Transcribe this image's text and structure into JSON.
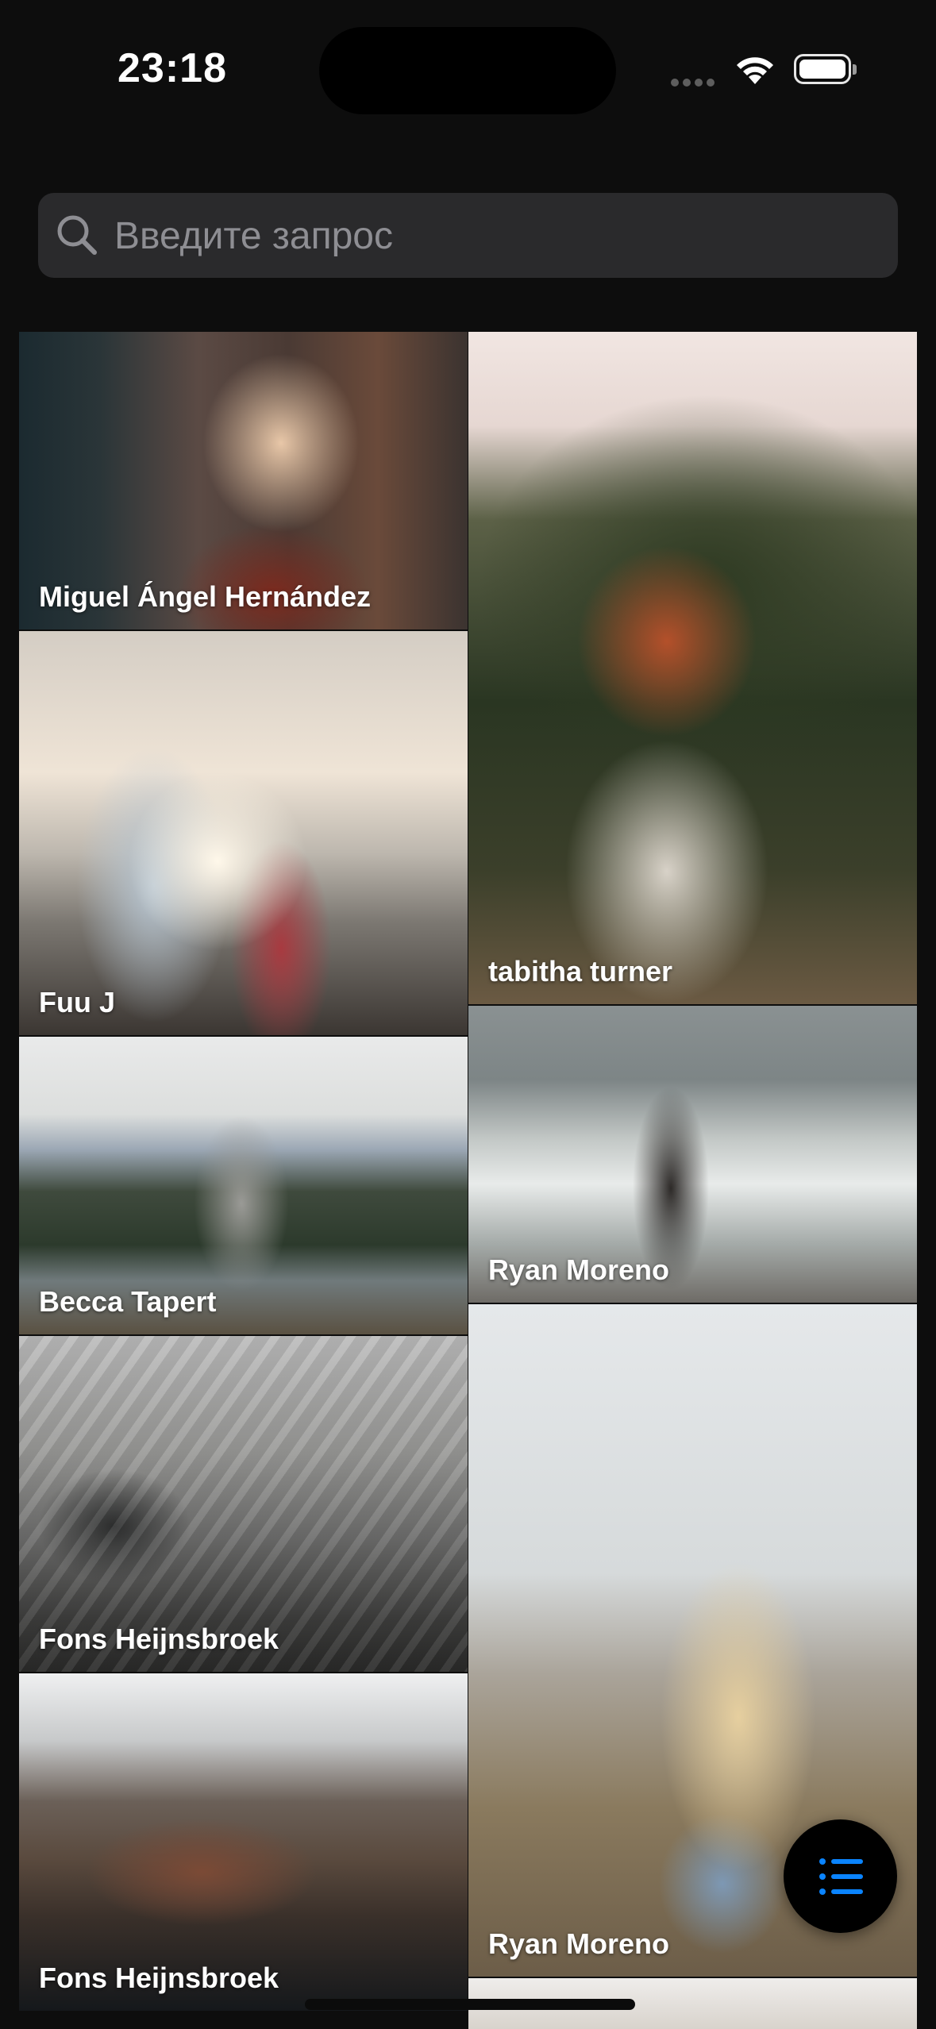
{
  "status_bar": {
    "time": "23:18",
    "icons": [
      "signal-dots-icon",
      "wifi-icon",
      "battery-icon"
    ]
  },
  "search": {
    "placeholder": "Введите запрос",
    "value": "",
    "icon": "search-icon"
  },
  "grid": {
    "tiles": [
      {
        "caption": "Miguel Ángel Hernández"
      },
      {
        "caption": "tabitha turner"
      },
      {
        "caption": "Fuu J"
      },
      {
        "caption": "Becca Tapert"
      },
      {
        "caption": "Ryan Moreno"
      },
      {
        "caption": "Fons Heijnsbroek"
      },
      {
        "caption": "Ryan Moreno"
      },
      {
        "caption": "Fons Heijnsbroek"
      }
    ]
  },
  "fab": {
    "icon": "list-icon"
  },
  "colors": {
    "background": "#0d0d0d",
    "search_bg": "#2a2a2c",
    "placeholder": "#8e8e93",
    "fab_icon": "#0a84ff"
  }
}
